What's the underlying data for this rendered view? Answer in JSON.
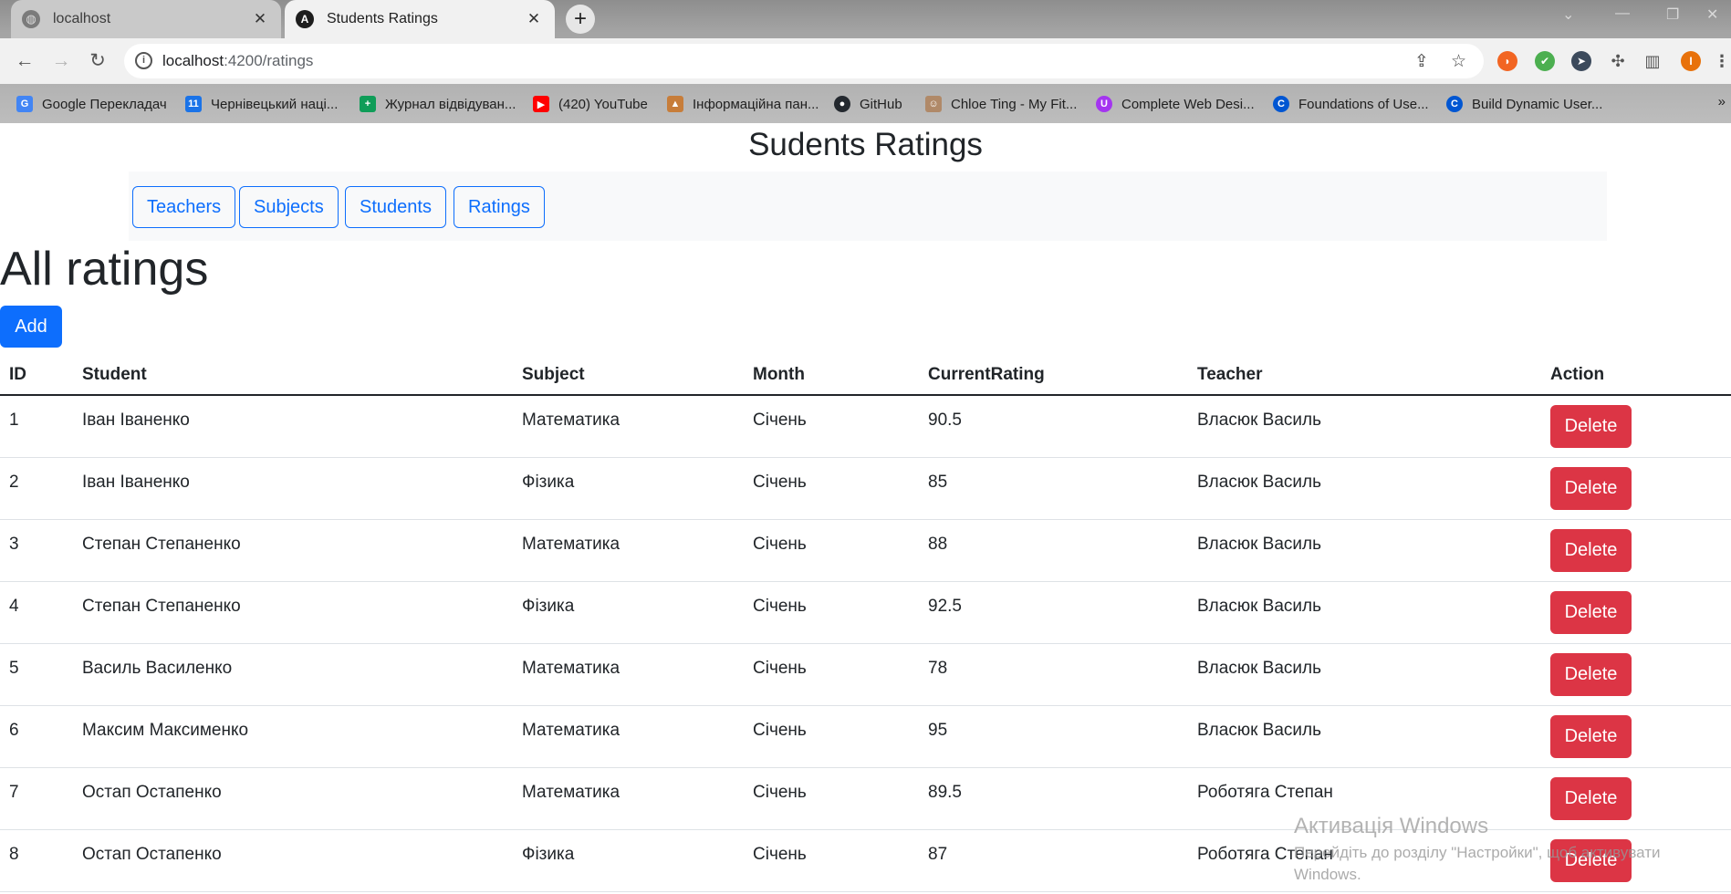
{
  "browser": {
    "tabs": [
      {
        "title": "localhost",
        "active": false,
        "icon": "globe-icon"
      },
      {
        "title": "Students Ratings",
        "active": true,
        "icon": "angular-icon"
      }
    ],
    "url_host": "localhost",
    "url_path": ":4200/ratings",
    "bookmarks": [
      {
        "label": "Google Перекладач",
        "icon": "google-translate-icon",
        "color": "#4285f4"
      },
      {
        "label": "Чернівецький наці...",
        "icon": "calendar-icon",
        "color": "#1a73e8"
      },
      {
        "label": "Журнал відвідуван...",
        "icon": "sheets-icon",
        "color": "#0f9d58"
      },
      {
        "label": "(420) YouTube",
        "icon": "youtube-icon",
        "color": "#ff0000"
      },
      {
        "label": "Інформаційна пан...",
        "icon": "graduation-icon",
        "color": "#c77d3a"
      },
      {
        "label": "GitHub",
        "icon": "github-icon",
        "color": "#24292f"
      },
      {
        "label": "Chloe Ting - My Fit...",
        "icon": "avatar-icon",
        "color": "#b08968"
      },
      {
        "label": "Complete Web Desi...",
        "icon": "udemy-icon",
        "color": "#a435f0"
      },
      {
        "label": "Foundations of Use...",
        "icon": "coursera-icon",
        "color": "#0056d2"
      },
      {
        "label": "Build Dynamic User...",
        "icon": "coursera-icon",
        "color": "#0056d2"
      }
    ],
    "bookmarks_more": "»"
  },
  "app": {
    "title": "Sudents Ratings",
    "nav": [
      "Teachers",
      "Subjects",
      "Students",
      "Ratings"
    ],
    "heading": "All ratings",
    "add_label": "Add"
  },
  "table": {
    "headers": [
      "ID",
      "Student",
      "Subject",
      "Month",
      "CurrentRating",
      "Teacher",
      "Action"
    ],
    "delete_label": "Delete",
    "rows": [
      [
        "1",
        "Іван Іваненко",
        "Математика",
        "Січень",
        "90.5",
        "Власюк Василь"
      ],
      [
        "2",
        "Іван Іваненко",
        "Фізика",
        "Січень",
        "85",
        "Власюк Василь"
      ],
      [
        "3",
        "Степан Степаненко",
        "Математика",
        "Січень",
        "88",
        "Власюк Василь"
      ],
      [
        "4",
        "Степан Степаненко",
        "Фізика",
        "Січень",
        "92.5",
        "Власюк Василь"
      ],
      [
        "5",
        "Василь Василенко",
        "Математика",
        "Січень",
        "78",
        "Власюк Василь"
      ],
      [
        "6",
        "Максим Максименко",
        "Математика",
        "Січень",
        "95",
        "Власюк Василь"
      ],
      [
        "7",
        "Остап Остапенко",
        "Математика",
        "Січень",
        "89.5",
        "Роботяга Степан"
      ],
      [
        "8",
        "Остап Остапенко",
        "Фізика",
        "Січень",
        "87",
        "Роботяга Степан"
      ]
    ]
  },
  "watermark": {
    "line1": "Активація Windows",
    "line2": "Перейдіть до розділу \"Настройки\", щоб активувати",
    "line3": "Windows."
  },
  "colors": {
    "primary": "#0d6efd",
    "danger": "#dc3545",
    "navbar_bg": "#f8f9fa"
  }
}
